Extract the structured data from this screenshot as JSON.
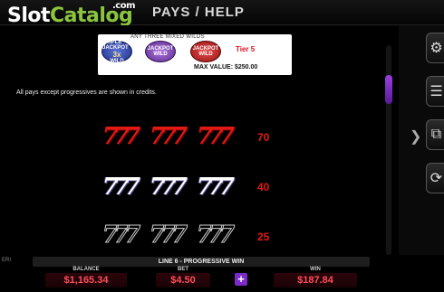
{
  "logo": {
    "slot": "Slot",
    "catalog": "Catalog",
    "com": ".com"
  },
  "header": {
    "title": "PAYS / HELP"
  },
  "wild_panel": {
    "caption": "ANY THREE MIXED WILDS",
    "wilds": [
      {
        "top": "TRIPLE JACKPOT",
        "mid": "3x",
        "bottom": "WILD"
      },
      {
        "top": "JACKPOT",
        "mid": "",
        "bottom": "WILD"
      },
      {
        "top": "JACKPOT",
        "mid": "",
        "bottom": "WILD"
      }
    ],
    "tier": "Tier 5",
    "max_value": "MAX VALUE: $250.00"
  },
  "info_text": "All pays except progressives are shown in credits.",
  "pay_rows": [
    {
      "symbol": "777",
      "style": "red",
      "pay": "70"
    },
    {
      "symbol": "777",
      "style": "white",
      "pay": "40"
    },
    {
      "symbol": "777",
      "style": "outline",
      "pay": "25"
    }
  ],
  "side_buttons": [
    {
      "icon": "gear-icon",
      "glyph": "⚙"
    },
    {
      "icon": "coin-stack-icon",
      "glyph": "☰"
    },
    {
      "icon": "paytable-icon",
      "glyph": "⧉"
    },
    {
      "icon": "autoplay-icon",
      "glyph": "⟳"
    }
  ],
  "bottom": {
    "brand": "ERI",
    "line_info": "LINE 6 - PROGRESSIVE WIN",
    "balance_label": "BALANCE",
    "balance": "$1,165.34",
    "bet_label": "BET",
    "bet": "$4.50",
    "plus": "+",
    "win_label": "WIN",
    "win": "$187.84"
  },
  "colors": {
    "accent_purple": "#7b2bc9",
    "pay_red": "#e11a16",
    "logo_green": "#8bc53f"
  }
}
